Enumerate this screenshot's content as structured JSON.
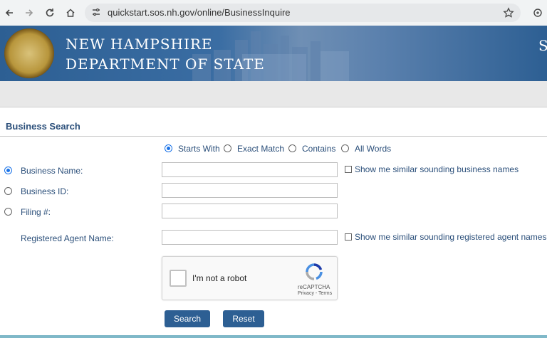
{
  "browser": {
    "url": "quickstart.sos.nh.gov/online/BusinessInquire",
    "icons": [
      "back-arrow-icon",
      "forward-arrow-icon",
      "reload-icon",
      "home-icon",
      "site-settings-icon",
      "star-icon",
      "extension-icon"
    ]
  },
  "banner": {
    "line1": "NEW HAMPSHIRE",
    "line2": "DEPARTMENT OF STATE",
    "cut_text": "S"
  },
  "section": {
    "title": "Business Search"
  },
  "match_options": [
    {
      "label": "Starts With",
      "selected": true
    },
    {
      "label": "Exact Match",
      "selected": false
    },
    {
      "label": "Contains",
      "selected": false
    },
    {
      "label": "All Words",
      "selected": false
    }
  ],
  "fields": {
    "business_name": {
      "label": "Business Name:",
      "value": "",
      "selected": true
    },
    "business_id": {
      "label": "Business ID:",
      "value": "",
      "selected": false
    },
    "filing": {
      "label": "Filing #:",
      "value": "",
      "selected": false
    },
    "agent": {
      "label": "Registered Agent Name:",
      "value": ""
    }
  },
  "checkboxes": {
    "similar_business": "Show me similar sounding business names",
    "similar_agent": "Show me similar sounding registered agent names"
  },
  "captcha": {
    "label": "I'm not a robot",
    "brand": "reCAPTCHA",
    "links": "Privacy - Terms"
  },
  "buttons": {
    "search": "Search",
    "reset": "Reset"
  },
  "colors": {
    "primary": "#2d5f93",
    "label": "#2b4f7a",
    "radio_selected": "#1a73e8"
  }
}
